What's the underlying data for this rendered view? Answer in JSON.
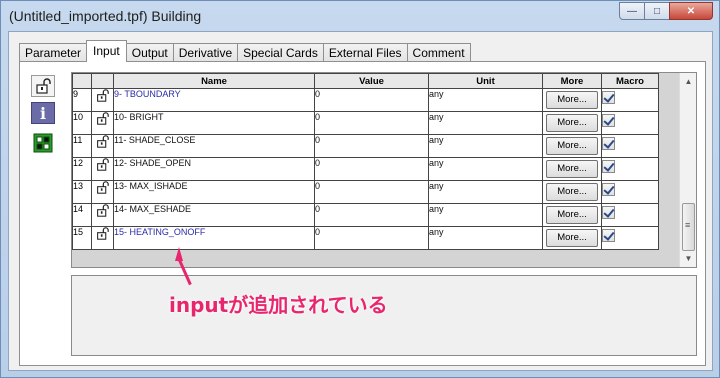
{
  "window": {
    "title": "(Untitled_imported.tpf) Building",
    "minimize_glyph": "—",
    "maximize_glyph": "□",
    "close_glyph": "✕"
  },
  "tabs": [
    "Parameter",
    "Input",
    "Output",
    "Derivative",
    "Special Cards",
    "External Files",
    "Comment"
  ],
  "active_tab": "Input",
  "side_icons": [
    "lock-icon",
    "info-icon",
    "chip-icon"
  ],
  "info_icon_glyph": "i",
  "grid": {
    "headers": {
      "name": "Name",
      "value": "Value",
      "unit": "Unit",
      "more": "More",
      "macro": "Macro"
    },
    "rows": [
      {
        "num": "9",
        "name": "9- TBOUNDARY",
        "value": "0",
        "unit": "any",
        "more": "More...",
        "macro": true,
        "highlight": true
      },
      {
        "num": "10",
        "name": "10- BRIGHT",
        "value": "0",
        "unit": "any",
        "more": "More...",
        "macro": true,
        "highlight": false
      },
      {
        "num": "11",
        "name": "11- SHADE_CLOSE",
        "value": "0",
        "unit": "any",
        "more": "More...",
        "macro": true,
        "highlight": false
      },
      {
        "num": "12",
        "name": "12- SHADE_OPEN",
        "value": "0",
        "unit": "any",
        "more": "More...",
        "macro": true,
        "highlight": false
      },
      {
        "num": "13",
        "name": "13- MAX_ISHADE",
        "value": "0",
        "unit": "any",
        "more": "More...",
        "macro": true,
        "highlight": false
      },
      {
        "num": "14",
        "name": "14- MAX_ESHADE",
        "value": "0",
        "unit": "any",
        "more": "More...",
        "macro": true,
        "highlight": false
      },
      {
        "num": "15",
        "name": "15- HEATING_ONOFF",
        "value": "0",
        "unit": "any",
        "more": "More...",
        "macro": true,
        "highlight": true
      }
    ]
  },
  "scrollbar": {
    "up_glyph": "▲",
    "down_glyph": "▼"
  },
  "annotation": "inputが追加されている",
  "colors": {
    "annotation": "#e8266e",
    "highlight_name": "#2a2aa8"
  }
}
